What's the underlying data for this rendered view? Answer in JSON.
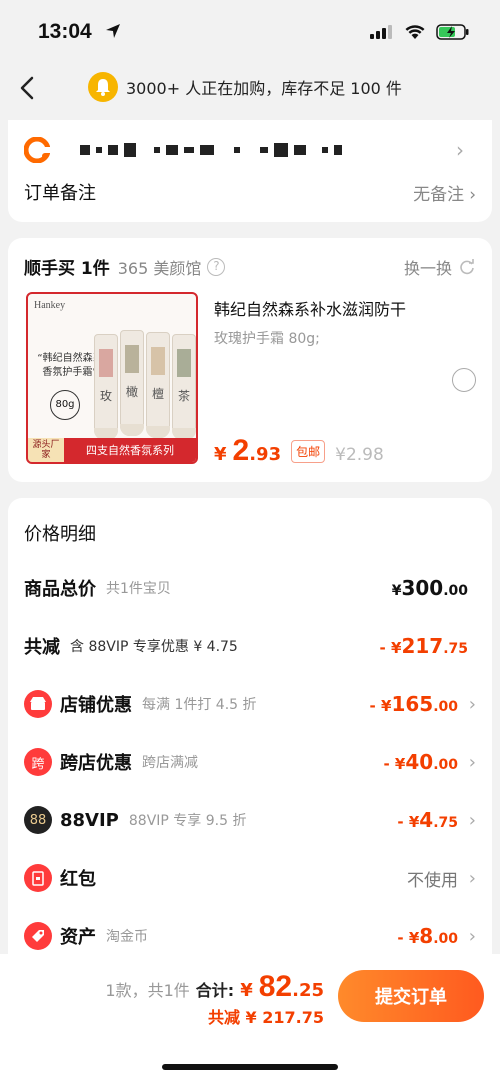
{
  "status": {
    "time": "13:04"
  },
  "notice": {
    "text": "3000+ 人正在加购，库存不足 100 件"
  },
  "order": {
    "remark_label": "订单备注",
    "remark_value": "无备注"
  },
  "addon": {
    "title": "顺手买 1件",
    "shop": "365 美颜馆",
    "swap_label": "换一换",
    "product": {
      "brand": "Hankey",
      "tag": "“韩纪自然森系香氛护手霜”",
      "weight": "80g",
      "tube_chars": [
        "玫",
        "橄",
        "檀",
        "茶"
      ],
      "source_tag": "源头厂家",
      "series_tag": "四支自然香氛系列",
      "title": "韩纪自然森系补水滋润防干",
      "spec": "玫瑰护手霜 80g;",
      "price_currency": "¥",
      "price_int": "2",
      "price_dec": ".93",
      "free_ship": "包邮",
      "orig_price": "¥2.98"
    }
  },
  "detail": {
    "title": "价格明细",
    "rows": [
      {
        "label": "商品总价",
        "sub": "共1件宝贝",
        "cur": "¥",
        "int": "300",
        "dec": ".00"
      },
      {
        "label": "共减",
        "sub": "含 88VIP 专享优惠 ¥ 4.75",
        "cur": "- ¥",
        "int": "217",
        "dec": ".75"
      },
      {
        "label": "店铺优惠",
        "sub": "每满 1件打 4.5 折",
        "cur": "- ¥",
        "int": "165",
        "dec": ".00"
      },
      {
        "label": "跨店优惠",
        "sub": "跨店满减",
        "cur": "- ¥",
        "int": "40",
        "dec": ".00"
      },
      {
        "label": "88VIP",
        "sub": "88VIP 专享 9.5 折",
        "cur": "- ¥",
        "int": "4",
        "dec": ".75"
      },
      {
        "label": "红包",
        "sub": "",
        "value": "不使用"
      },
      {
        "label": "资产",
        "sub": "淘金币",
        "cur": "- ¥",
        "int": "8",
        "dec": ".00"
      }
    ],
    "icon_kua": "跨",
    "icon_88": "88"
  },
  "footer": {
    "count": "1款，共1件",
    "total_label": "合计:",
    "total_cur": "¥",
    "total_int": "82",
    "total_dec": ".25",
    "reduce": "共减 ¥ 217.75",
    "submit": "提交订单"
  },
  "colors": {
    "accent": "#f33f00",
    "button": "#ff6a24",
    "page_bg": "#f2f2f2"
  }
}
